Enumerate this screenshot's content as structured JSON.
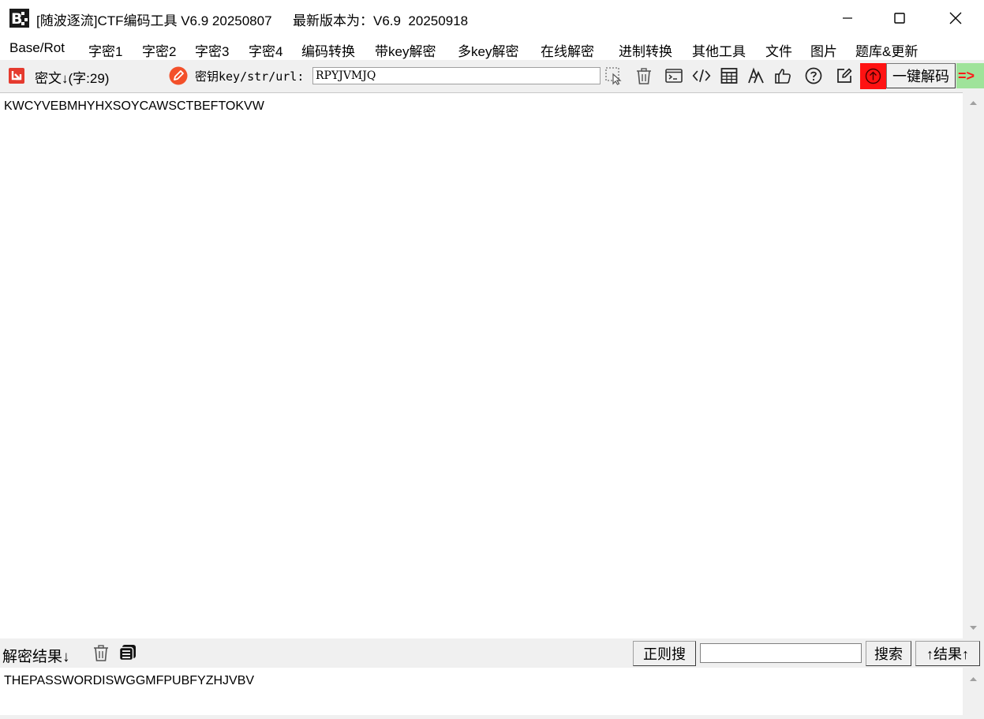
{
  "window": {
    "title": "[随波逐流]CTF编码工具 V6.9 20250807",
    "latest_version": "最新版本为：V6.9  20250918",
    "minimize_glyph": "—",
    "maximize_glyph": "☐",
    "close_glyph": "✕"
  },
  "menubar": {
    "items": [
      {
        "label": "Base/Rot"
      },
      {
        "label": "字密1"
      },
      {
        "label": "字密2"
      },
      {
        "label": "字密3"
      },
      {
        "label": "字密4"
      },
      {
        "label": "编码转换"
      },
      {
        "label": "带key解密"
      },
      {
        "label": "多key解密"
      },
      {
        "label": "在线解密"
      },
      {
        "label": "进制转换"
      },
      {
        "label": "其他工具"
      },
      {
        "label": "文件"
      },
      {
        "label": "图片"
      },
      {
        "label": "题库&更新"
      }
    ]
  },
  "toolbar": {
    "cipher_label": "密文↓(字:29)",
    "key_label": "密钥key/str/url:",
    "key_value": "RPYJVMJQ",
    "decode_button": "一键解码",
    "arrow_indicator": "=>",
    "accent_red": "#ff1212",
    "accent_green": "#9fe39a"
  },
  "cipher": {
    "text": "KWCYVEBMHYHXSOYCAWSCTBEFTOKVW"
  },
  "result_bar": {
    "label": "解密结果↓",
    "regex_search_button": "正则搜",
    "search_value": "",
    "search_button": "搜索",
    "move_up_button": "↑结果↑"
  },
  "result": {
    "text": "THEPASSWORDISWGGMFPUBFYZHJVBV"
  },
  "icons": [
    "app-logo-icon",
    "import-icon",
    "key-edit-icon",
    "select-pointer-icon",
    "trash-icon",
    "terminal-icon",
    "code-icon",
    "table-icon",
    "font-icon",
    "thumbs-up-icon",
    "help-icon",
    "edit-icon",
    "upload-icon",
    "copy-icon"
  ]
}
